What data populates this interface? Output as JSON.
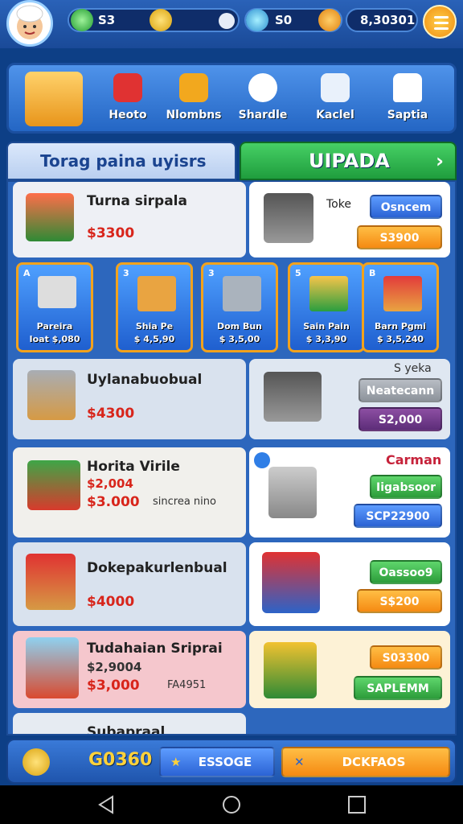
{
  "topbar": {
    "currency1": "S3",
    "currency2": "S0",
    "balance": "8,30301"
  },
  "categories": [
    {
      "label": "Heoto",
      "icon": "book-icon"
    },
    {
      "label": "Nlombns",
      "icon": "box-icon"
    },
    {
      "label": "Shardle",
      "icon": "gear-icon"
    },
    {
      "label": "Kaclel",
      "icon": "cart-icon"
    },
    {
      "label": "Saptia",
      "icon": "house-icon"
    }
  ],
  "tabs": {
    "tab1": "Torag paina uyisrs",
    "tab2": "UIPADA"
  },
  "rows": [
    {
      "name": "Turna sirpala",
      "price": "$3300",
      "right_label": "Toke",
      "btn_top": "Osncem",
      "btn_bottom": "S3900"
    },
    {
      "name": "Uylanabuobual",
      "price": "$4300",
      "right_label": "S yeka",
      "btn_top": "Neatecann",
      "btn_bottom": "S2,000"
    },
    {
      "name": "Horita Virile",
      "price_old": "$2,004",
      "price": "$3.000",
      "extra": "sincrea nino",
      "right_label": "Carman",
      "btn_top": "Iigabsoor",
      "btn_bottom": "SCP22900"
    },
    {
      "name": "Dokepakurlenbual",
      "price": "$4000",
      "btn_top": "Oassoo9",
      "btn_bottom": "S$200"
    },
    {
      "name": "Tudahaian Sriprai",
      "price_old": "$2,9004",
      "price": "$3,000",
      "extra": "FA4951",
      "btn_top": "S03300",
      "btn_bottom": "SAPLEMM"
    }
  ],
  "minis": [
    {
      "num": "A",
      "name": "Pareira",
      "price": "Ioat $,080"
    },
    {
      "num": "3",
      "name": "Shia Pe",
      "price": "$ 4,5,90"
    },
    {
      "num": "3",
      "name": "Dom Bun",
      "price": "$ 3,5,00"
    },
    {
      "num": "5",
      "name": "Sain Pain",
      "price": "$ 3,3,90"
    },
    {
      "num": "B",
      "name": "Barn Pgmi",
      "price": "$ 3,5,240"
    }
  ],
  "partial_row": "Subapraal",
  "bottom": {
    "coins": "G0360",
    "btn_middle": "ESSOGE",
    "btn_right": "DCKFAOS"
  },
  "colors": {
    "accent_blue": "#2d67bd",
    "accent_green": "#2c9c3a",
    "accent_orange": "#f58a12",
    "price_red": "#d8251b"
  }
}
